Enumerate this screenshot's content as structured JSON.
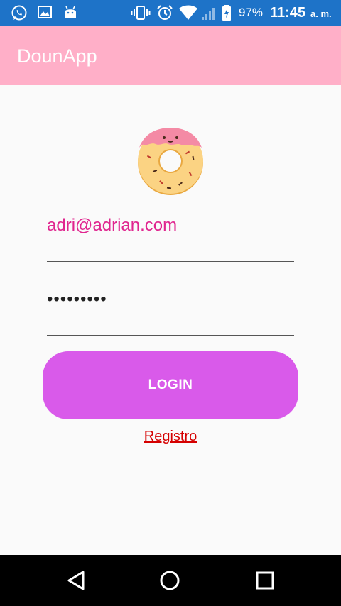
{
  "status_bar": {
    "battery_percent": "97%",
    "time": "11:45",
    "ampm": "a. m.",
    "icons": [
      "whatsapp-icon",
      "image-icon",
      "android-icon",
      "vibrate-icon",
      "alarm-icon",
      "wifi-icon",
      "signal-icon",
      "battery-icon"
    ]
  },
  "app_bar": {
    "title": "DounApp"
  },
  "form": {
    "email_value": "adri@adrian.com",
    "password_value": "•••••••••",
    "login_label": "LOGIN",
    "register_label": "Registro"
  },
  "colors": {
    "status_bar": "#1e73c8",
    "app_bar": "#ffafc8",
    "accent_text": "#e0258f",
    "button": "#d95aea",
    "link": "#d50000"
  },
  "nav_bar": {
    "icons": [
      "back-icon",
      "home-icon",
      "recents-icon"
    ]
  }
}
